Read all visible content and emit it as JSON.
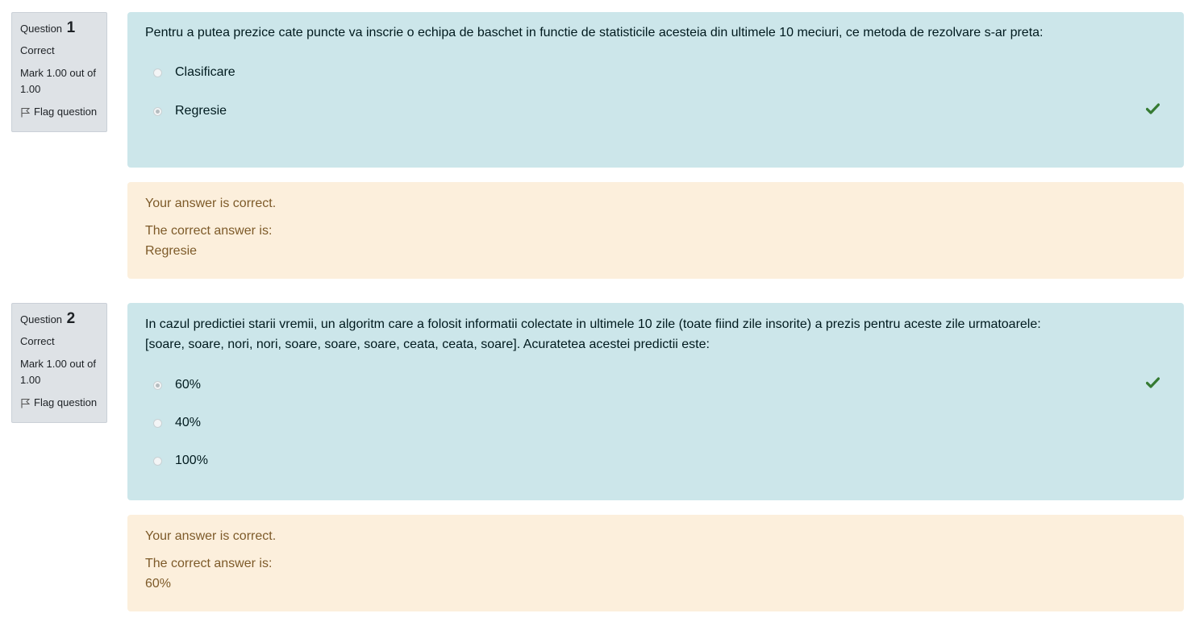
{
  "questions": [
    {
      "question_word": "Question",
      "number": "1",
      "state": "Correct",
      "grade": "Mark 1.00 out of 1.00",
      "flag_label": "Flag question",
      "text": "Pentru a putea prezice cate puncte va inscrie o echipa de baschet in functie de statisticile acesteia din ultimele 10 meciuri, ce metoda de rezolvare s-ar preta:",
      "answers": [
        {
          "label": "Clasificare",
          "selected": false
        },
        {
          "label": "Regresie",
          "selected": true
        }
      ],
      "feedback": "Your answer is correct.",
      "right_answer_label": "The correct answer is:",
      "right_answer": "Regresie"
    },
    {
      "question_word": "Question",
      "number": "2",
      "state": "Correct",
      "grade": "Mark 1.00 out of 1.00",
      "flag_label": "Flag question",
      "text_line1": "In cazul predictiei starii vremii, un algoritm care a folosit informatii colectate in ultimele 10 zile (toate fiind zile insorite) a prezis pentru aceste zile urmatoarele:",
      "text_line2": "[soare, soare, nori, nori, soare, soare, soare, ceata, ceata, soare]. Acuratetea acestei predictii este:",
      "answers": [
        {
          "label": "60%",
          "selected": true
        },
        {
          "label": "40%",
          "selected": false
        },
        {
          "label": "100%",
          "selected": false
        }
      ],
      "feedback": "Your answer is correct.",
      "right_answer_label": "The correct answer is:",
      "right_answer": "60%"
    }
  ],
  "colors": {
    "formulation_bg": "#cce6ea",
    "outcome_bg": "#fcefdc",
    "info_bg": "#dee2e6",
    "correct_tick": "#357a32"
  },
  "icons": {
    "correct": "check-icon",
    "flag": "flag-icon"
  }
}
